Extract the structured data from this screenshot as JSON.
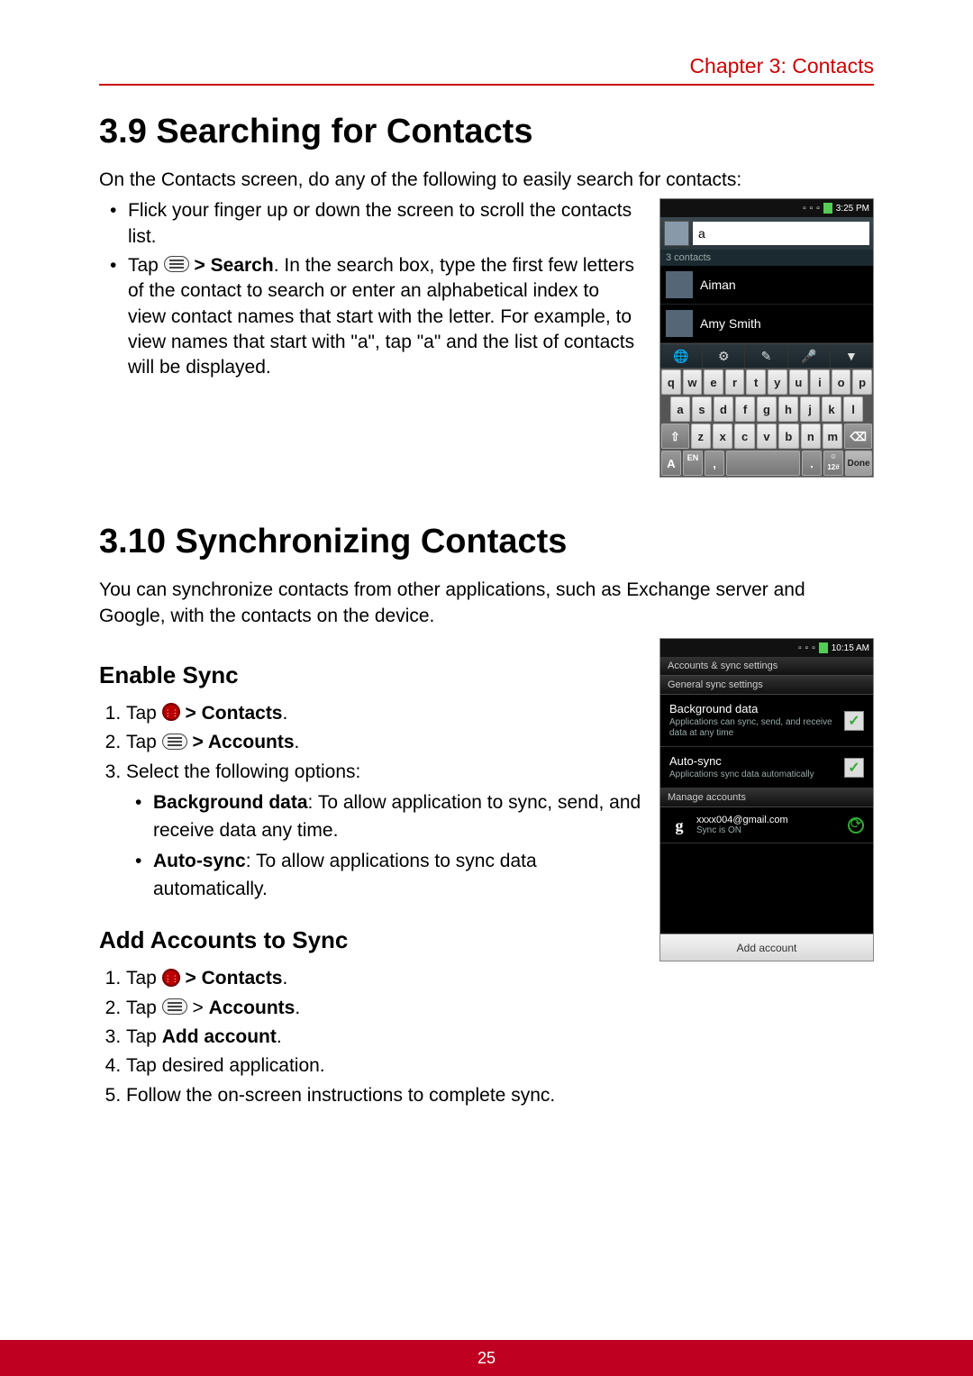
{
  "header": {
    "chapter": "Chapter 3: Contacts"
  },
  "section39": {
    "title": "3.9 Searching for Contacts",
    "intro": "On the Contacts screen, do any of the following to easily search for contacts:",
    "bullet1": "Flick your finger up or down the screen to scroll the contacts list.",
    "bullet2_pre": "Tap ",
    "bullet2_search": " > Search",
    "bullet2_rest": ". In the search box, type the first few letters of the contact to search or enter an alphabetical index to view contact names that start with the letter. For example, to view names that start with \"a\", tap \"a\" and the list of contacts will be displayed."
  },
  "phone1": {
    "time": "3:25 PM",
    "pm_suffix": "PM",
    "search_value": "a",
    "count": "3 contacts",
    "contact1": "Aiman",
    "contact2": "Amy Smith",
    "toolbar": {
      "globe": "🌐",
      "gear": "⚙",
      "edit": "✎",
      "mic": "🎤",
      "down": "▼"
    },
    "kbd": {
      "r1": [
        "q",
        "w",
        "e",
        "r",
        "t",
        "y",
        "u",
        "i",
        "o",
        "p"
      ],
      "r2": [
        "a",
        "s",
        "d",
        "f",
        "g",
        "h",
        "j",
        "k",
        "l"
      ],
      "r3_shift": "⇧",
      "r3": [
        "z",
        "x",
        "c",
        "v",
        "b",
        "n",
        "m"
      ],
      "r3_del": "⌫",
      "r4_mode": "A",
      "r4_lang": "EN",
      "r4_comma": ",",
      "r4_space": " ",
      "r4_dot": ".",
      "r4_emoji": "☺\n12#",
      "r4_done": "Done"
    }
  },
  "section310": {
    "title": "3.10 Synchronizing Contacts",
    "intro": "You can synchronize contacts from other applications, such as Exchange server and Google, with the contacts on the device."
  },
  "enable_sync": {
    "heading": "Enable Sync",
    "s1_pre": "Tap ",
    "s1_post": " > Contacts",
    "s2_pre": "Tap ",
    "s2_post": " > Accounts",
    "s3": "Select the following options:",
    "s3a_label": "Background data",
    "s3a_rest": ": To allow application to sync, send, and receive data any time.",
    "s3b_label": "Auto-sync",
    "s3b_rest": ": To allow applications to sync data automatically."
  },
  "add_accounts": {
    "heading": "Add Accounts to Sync",
    "s1_pre": "Tap ",
    "s1_post": " > Contacts",
    "s2_pre": "Tap ",
    "s2_mid": " > ",
    "s2_post": "Accounts",
    "s3_pre": "Tap ",
    "s3_post": "Add account",
    "s4": "Tap desired application.",
    "s5": "Follow the on-screen instructions to complete sync."
  },
  "phone2": {
    "time": "10:15 AM",
    "title": "Accounts & sync settings",
    "general": "General sync settings",
    "bg_title": "Background data",
    "bg_sub": "Applications can sync, send, and receive data at any time",
    "auto_title": "Auto-sync",
    "auto_sub": "Applications sync data automatically",
    "manage": "Manage accounts",
    "email": "xxxx004@gmail.com",
    "email_sub": "Sync is ON",
    "add": "Add account"
  },
  "footer": {
    "page": "25"
  }
}
